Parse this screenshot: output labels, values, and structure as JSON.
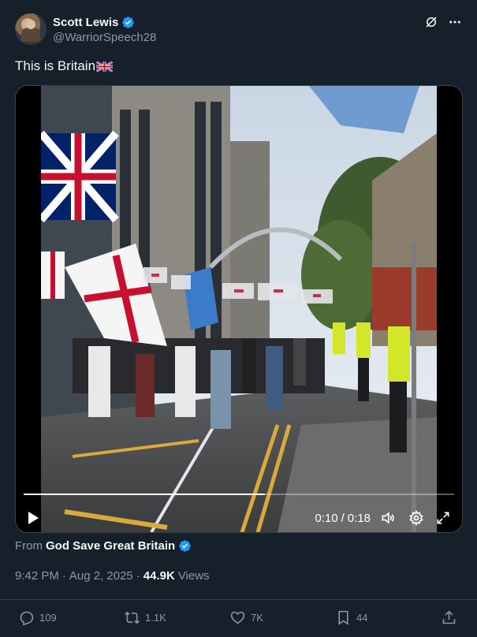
{
  "author": {
    "display_name": "Scott Lewis",
    "handle": "@WarriorSpeech28",
    "verified": true
  },
  "tweet": {
    "text": "This is Britain",
    "emoji": "uk-flag"
  },
  "video": {
    "current_time": "0:10",
    "separator": "/",
    "duration": "0:18",
    "progress": 0.56
  },
  "source": {
    "from_label": "From",
    "name": "God Save Great Britain"
  },
  "meta": {
    "time": "9:42 PM",
    "dot1": "·",
    "date": "Aug 2, 2025",
    "dot2": "·",
    "views_count": "44.9K",
    "views_label": "Views"
  },
  "actions": {
    "replies": "109",
    "reposts": "1.1K",
    "likes": "7K",
    "bookmarks": "44"
  },
  "colors": {
    "background": "#15202b",
    "accent": "#1d9bf0",
    "secondary_text": "#8b98a5"
  }
}
